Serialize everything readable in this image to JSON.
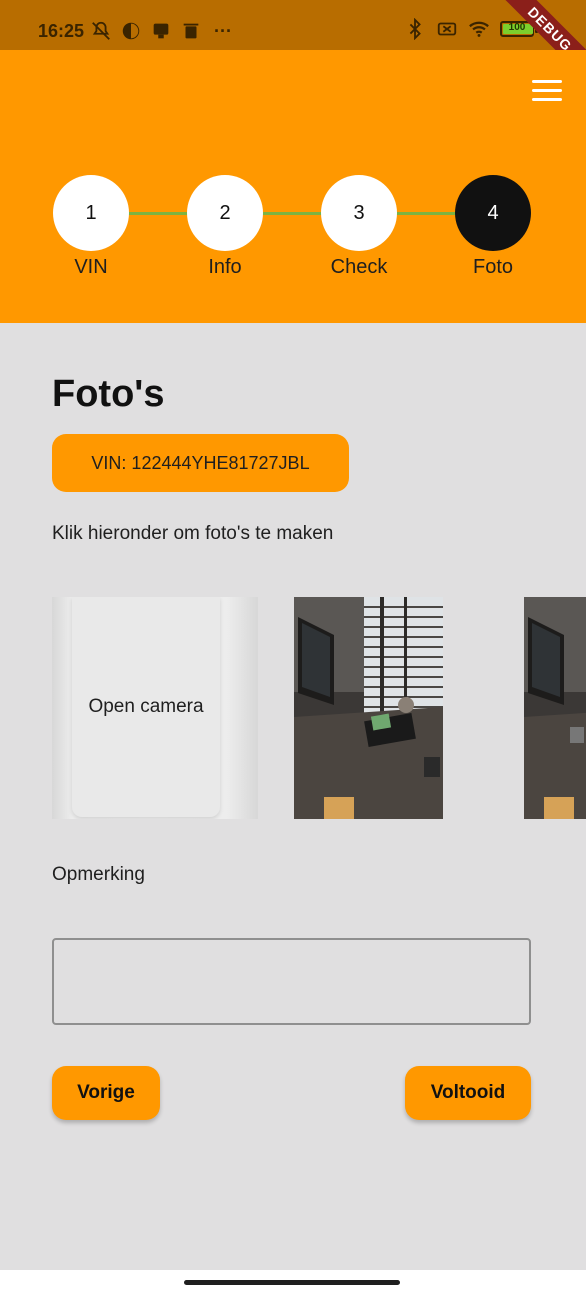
{
  "status_bar": {
    "time": "16:25",
    "overflow": "···",
    "battery_level": "100",
    "battery_fraction": 1.0,
    "left_icons": [
      "mute-icon",
      "theme-icon",
      "sim-card-icon",
      "trash-icon"
    ],
    "right_icons": [
      "bluetooth-icon",
      "no-sim-icon",
      "wifi-icon",
      "battery-icon"
    ]
  },
  "debug_banner": "DEBUG",
  "header": {
    "menu_icon": "hamburger-menu-icon",
    "accent_color": "#ff9800",
    "steps": [
      {
        "number": "1",
        "label": "VIN",
        "active": false
      },
      {
        "number": "2",
        "label": "Info",
        "active": false
      },
      {
        "number": "3",
        "label": "Check",
        "active": false
      },
      {
        "number": "4",
        "label": "Foto",
        "active": true
      }
    ],
    "connector_color": "#7cb342"
  },
  "main": {
    "title": "Foto's",
    "vin_badge": "VIN: 122444YHE81727JBL",
    "instructions": "Klik hieronder om foto's te maken",
    "camera_button": "Open camera",
    "photos_count_visible": 2,
    "remark_label": "Opmerking",
    "remark_value": "",
    "prev_button": "Vorige",
    "done_button": "Voltooid"
  }
}
